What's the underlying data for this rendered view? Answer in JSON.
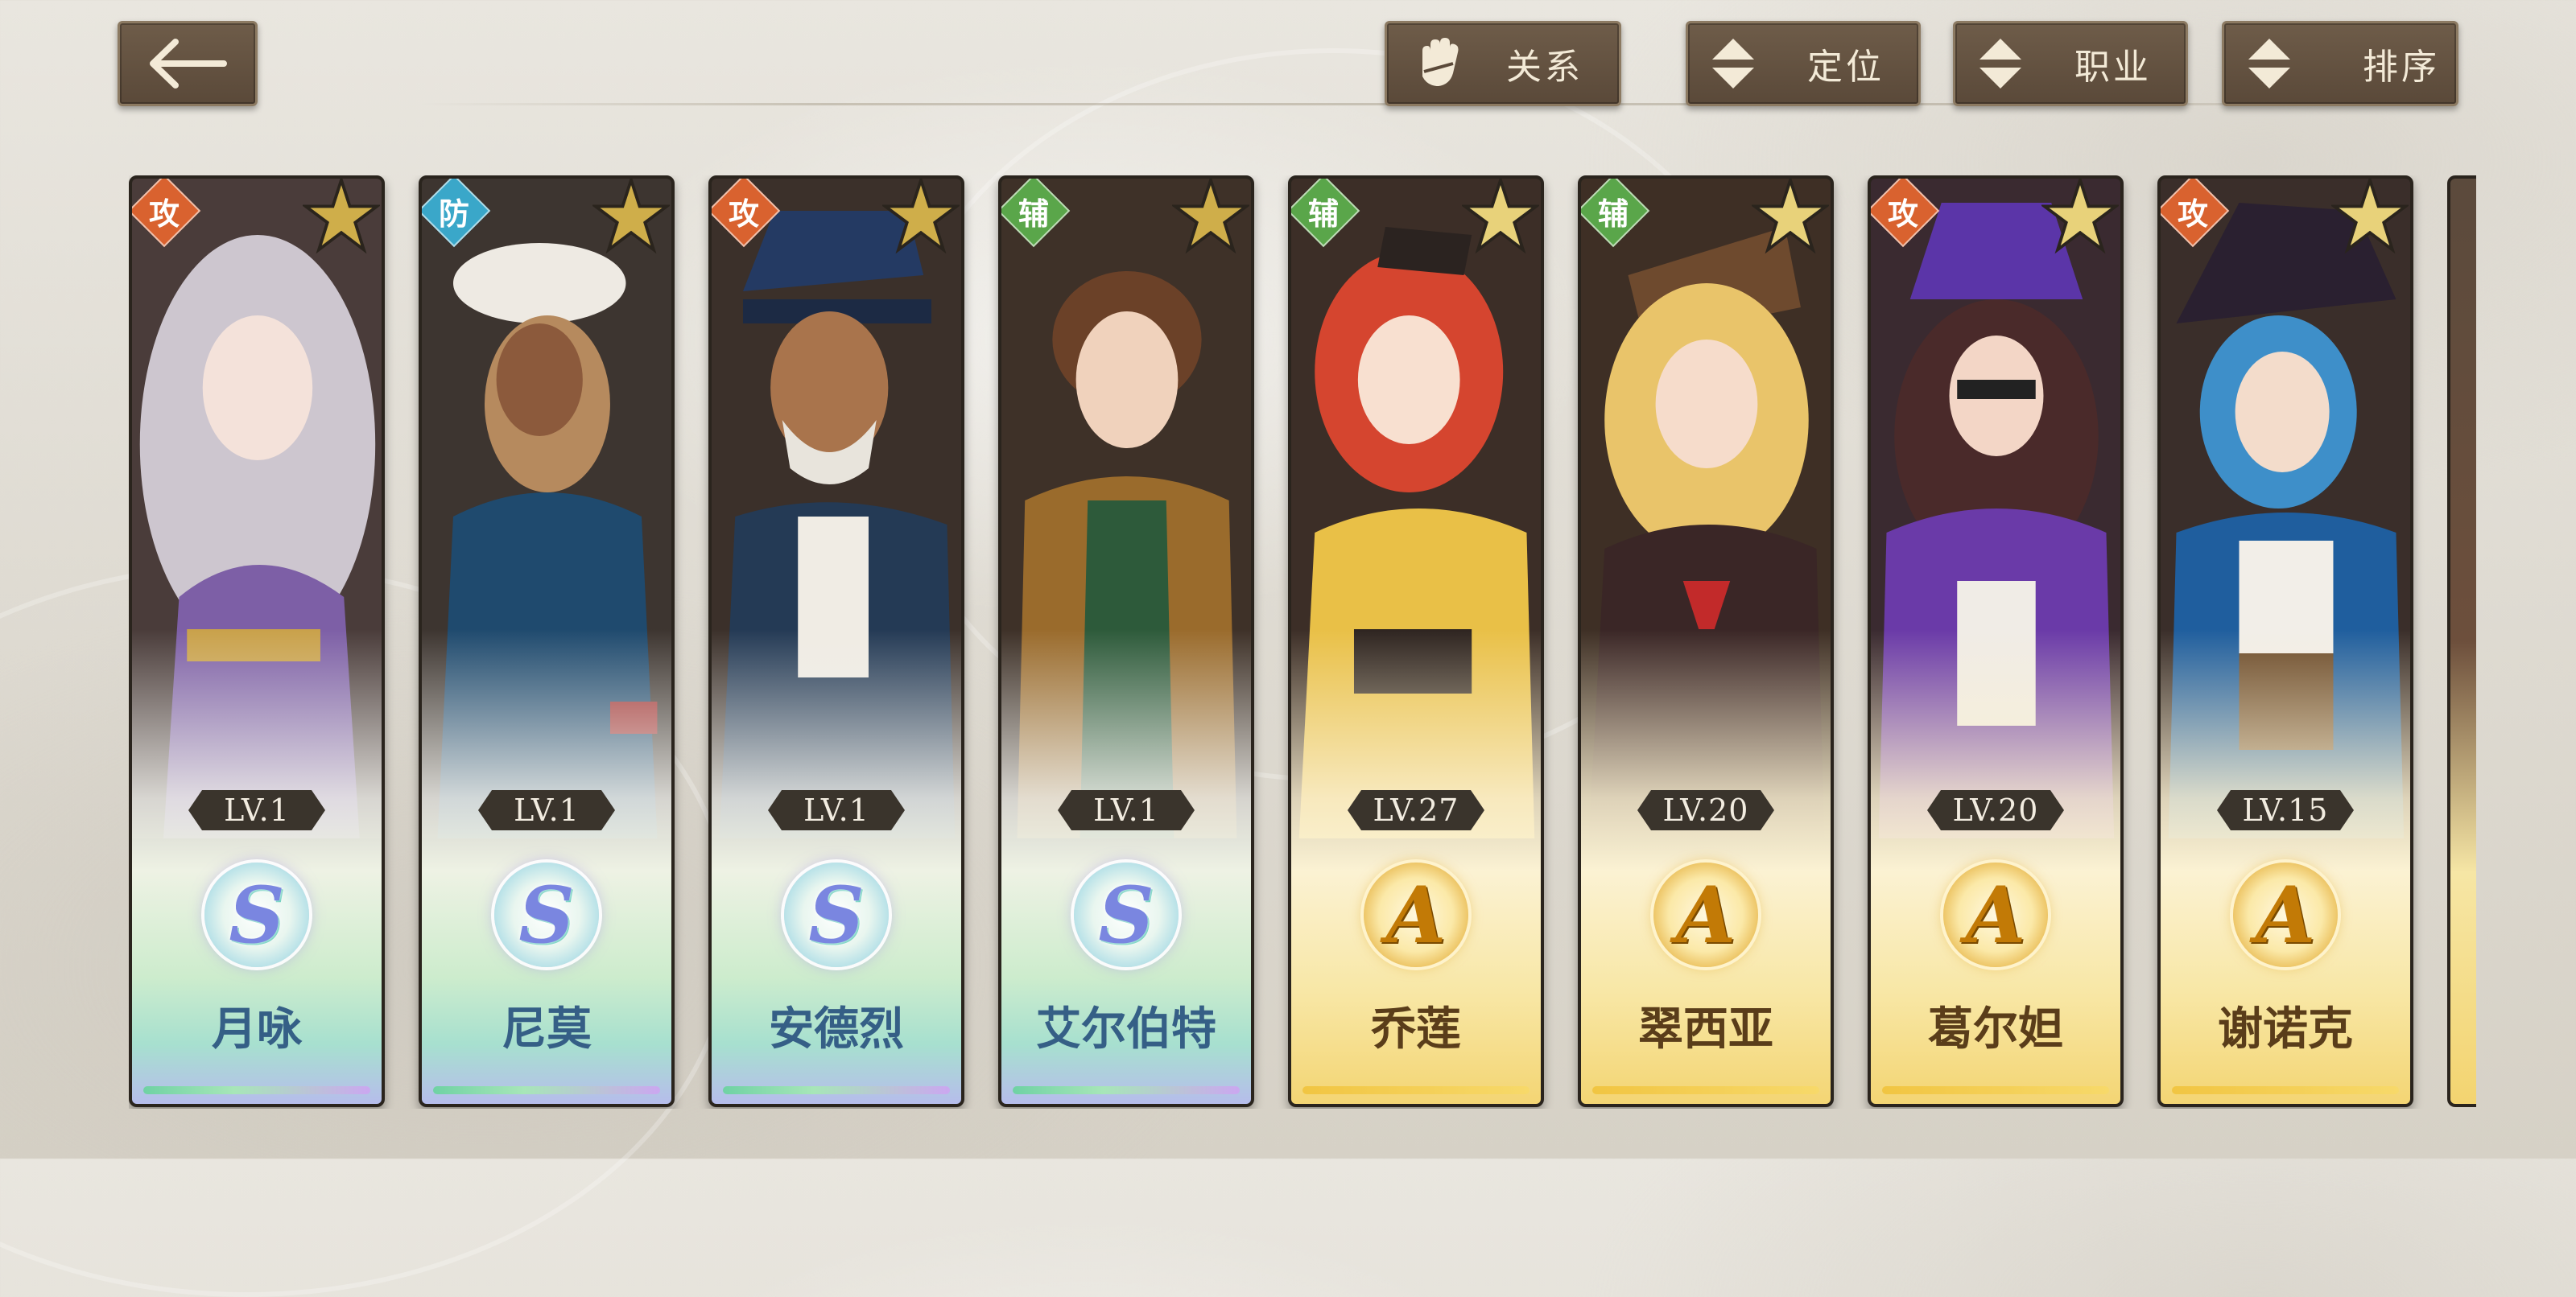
{
  "header": {
    "filters": [
      {
        "label": "关系",
        "icon": "glove-icon"
      },
      {
        "label": "定位",
        "icon": "sort-arrows-icon"
      },
      {
        "label": "职业",
        "icon": "sort-arrows-icon"
      },
      {
        "label": "排序",
        "icon": "sort-arrows-icon"
      }
    ],
    "back_icon": "back-arrow-icon"
  },
  "characters": [
    {
      "name": "月咏",
      "level": "LV.1",
      "rank": "S",
      "role": "攻",
      "role_color": "#d9622f"
    },
    {
      "name": "尼莫",
      "level": "LV.1",
      "rank": "S",
      "role": "防",
      "role_color": "#3aa7c9"
    },
    {
      "name": "安德烈",
      "level": "LV.1",
      "rank": "S",
      "role": "攻",
      "role_color": "#d9622f"
    },
    {
      "name": "艾尔伯特",
      "level": "LV.1",
      "rank": "S",
      "role": "辅",
      "role_color": "#5aa64a"
    },
    {
      "name": "乔莲",
      "level": "LV.27",
      "rank": "A",
      "role": "辅",
      "role_color": "#5aa64a"
    },
    {
      "name": "翠西亚",
      "level": "LV.20",
      "rank": "A",
      "role": "辅",
      "role_color": "#5aa64a"
    },
    {
      "name": "葛尔妲",
      "level": "LV.20",
      "rank": "A",
      "role": "攻",
      "role_color": "#d9622f"
    },
    {
      "name": "谢诺克",
      "level": "LV.15",
      "rank": "A",
      "role": "攻",
      "role_color": "#d9622f"
    }
  ]
}
